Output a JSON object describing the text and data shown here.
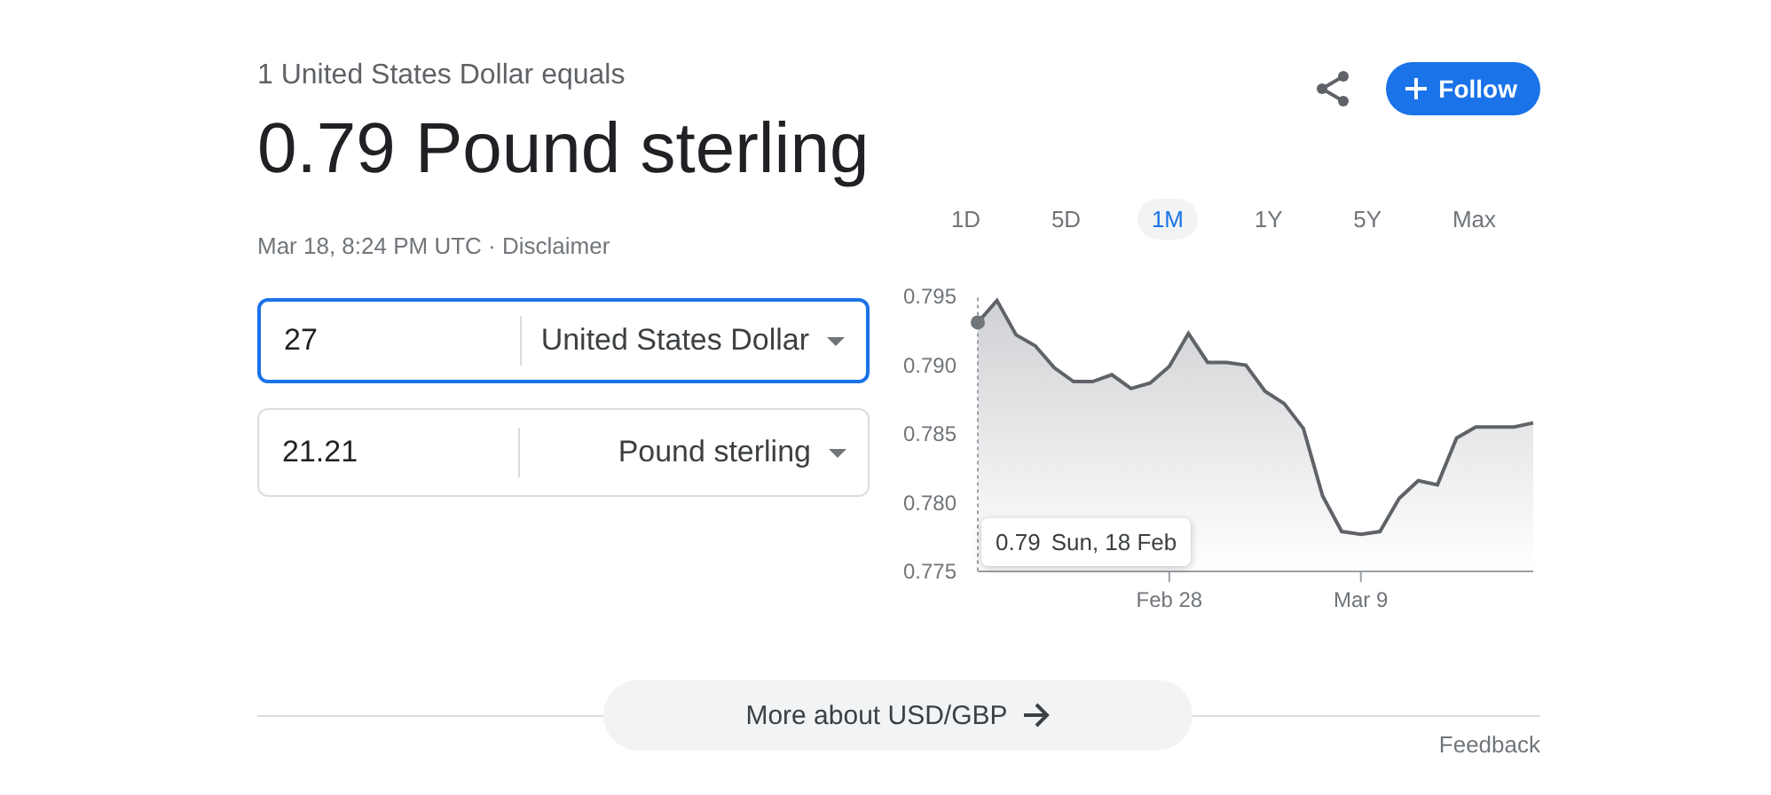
{
  "header": {
    "subtitle": "1 United States Dollar equals",
    "result": "0.79 Pound sterling",
    "meta": "Mar 18, 8:24 PM UTC · ",
    "disclaimer": "Disclaimer"
  },
  "actions": {
    "follow": "Follow"
  },
  "converter": [
    {
      "amount": "27",
      "currency": "United States Dollar",
      "focused": true
    },
    {
      "amount": "21.21",
      "currency": "Pound sterling",
      "focused": false
    }
  ],
  "ranges": [
    {
      "label": "1D",
      "selected": false
    },
    {
      "label": "5D",
      "selected": false
    },
    {
      "label": "1M",
      "selected": true
    },
    {
      "label": "1Y",
      "selected": false
    },
    {
      "label": "5Y",
      "selected": false
    },
    {
      "label": "Max",
      "selected": false
    }
  ],
  "chart": {
    "tooltip": {
      "value": "0.79",
      "date": "Sun, 18 Feb"
    },
    "chart_data": {
      "type": "area",
      "categories": [
        null,
        null,
        null,
        null,
        null,
        null,
        null,
        null,
        null,
        null,
        "Feb 28",
        null,
        null,
        null,
        null,
        null,
        null,
        null,
        null,
        null,
        "Mar 9",
        null,
        null,
        null,
        null,
        null,
        null,
        null,
        null,
        null
      ],
      "series": [
        {
          "color": "#5f6368",
          "values": [
            0.7931,
            0.7947,
            0.7922,
            0.7914,
            0.7898,
            0.7888,
            0.7888,
            0.7893,
            0.7883,
            0.7887,
            0.7899,
            0.7923,
            0.7902,
            0.7902,
            0.79,
            0.7881,
            0.7872,
            0.7854,
            0.7805,
            0.7779,
            0.7777,
            0.7779,
            0.7803,
            0.7816,
            0.7813,
            0.7847,
            0.7855,
            0.7855,
            0.7855,
            0.7858
          ]
        }
      ],
      "ylim": [
        0.775,
        0.795
      ],
      "yticks": [
        0.795,
        {
          "value": 0.79,
          "label": "0.790"
        },
        0.785,
        {
          "value": 0.78,
          "label": "0.780"
        },
        0.775
      ]
    }
  },
  "more": "More about USD/GBP",
  "feedback": "Feedback"
}
